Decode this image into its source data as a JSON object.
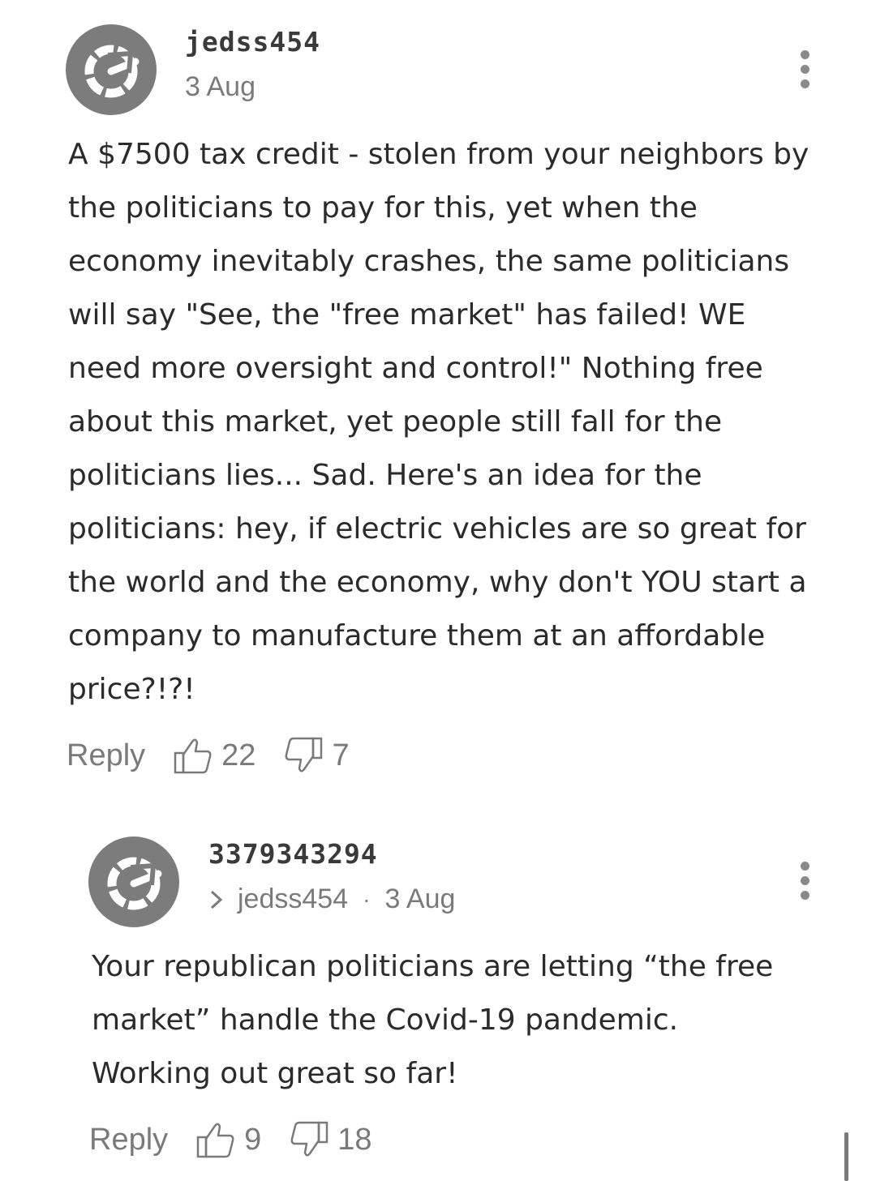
{
  "comments": [
    {
      "username": "jedss454",
      "date": "3 Aug",
      "text": "A $7500 tax credit - stolen from your neighbors by the politicians to pay for this, yet when the economy inevitably crashes, the same politicians will say \"See, the \"free market\" has failed! WE need more oversight and control!\" Nothing free about this market, yet people still fall for the politicians lies... Sad. Here's an idea for the politicians: hey, if electric vehicles are so great for the world and the economy, why don't YOU start a company to manufacture them at an affordable price?!?!",
      "reply_label": "Reply",
      "likes": "22",
      "dislikes": "7"
    },
    {
      "username": "3379343294",
      "replying_to": "jedss454",
      "separator": "·",
      "date": "3 Aug",
      "text": "Your republican politicians are letting “the free market” handle the Covid-19 pandemic. Working out great so far!",
      "reply_label": "Reply",
      "likes": "9",
      "dislikes": "18"
    }
  ],
  "icons": {
    "avatar": "gauge-logo-icon",
    "menu": "kebab-menu-icon",
    "like": "thumbs-up-icon",
    "dislike": "thumbs-down-icon",
    "reply_to": "chevron-right-icon"
  }
}
